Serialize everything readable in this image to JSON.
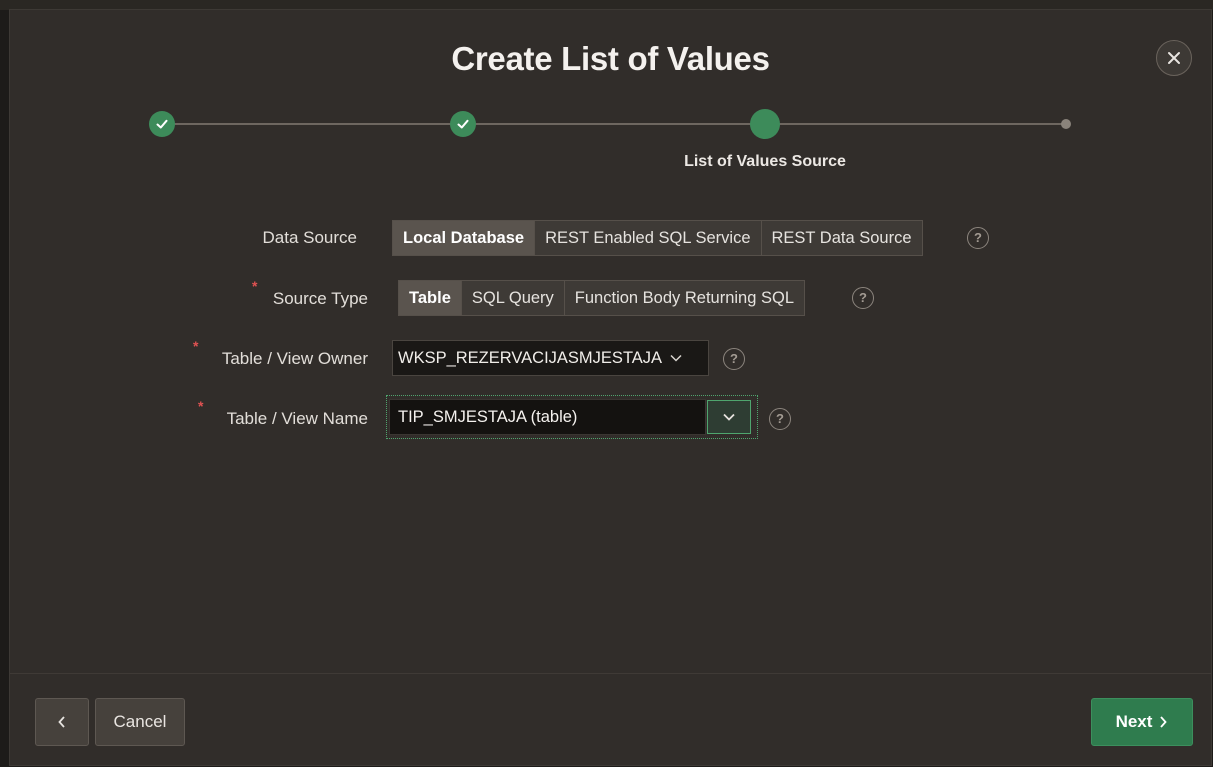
{
  "dialog": {
    "title": "Create List of Values",
    "close_icon": "close-icon"
  },
  "wizard": {
    "steps": [
      {
        "status": "complete"
      },
      {
        "status": "complete"
      },
      {
        "status": "current",
        "label": "List of Values Source"
      },
      {
        "status": "future"
      }
    ]
  },
  "form": {
    "data_source": {
      "label": "Data Source",
      "options": [
        "Local Database",
        "REST Enabled SQL Service",
        "REST Data Source"
      ],
      "selected": "Local Database"
    },
    "source_type": {
      "label": "Source Type",
      "required": true,
      "options": [
        "Table",
        "SQL Query",
        "Function Body Returning SQL"
      ],
      "selected": "Table"
    },
    "table_owner": {
      "label": "Table / View Owner",
      "required": true,
      "value": "WKSP_REZERVACIJASMJESTAJA"
    },
    "table_name": {
      "label": "Table / View Name",
      "required": true,
      "value": "TIP_SMJESTAJA (table)"
    },
    "required_marker": "*",
    "help_glyph": "?"
  },
  "footer": {
    "previous_icon": "chevron-left-icon",
    "cancel_label": "Cancel",
    "next_label": "Next"
  },
  "colors": {
    "accent_green": "#3d8b5a",
    "background": "#312d2a"
  }
}
